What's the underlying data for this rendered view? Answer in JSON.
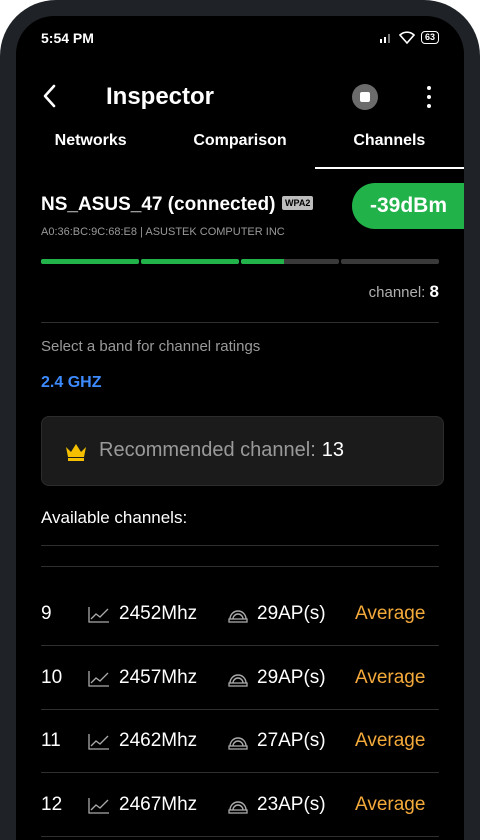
{
  "status_bar": {
    "time": "5:54 PM",
    "battery": "63"
  },
  "header": {
    "title": "Inspector"
  },
  "tabs": [
    {
      "label": "Networks"
    },
    {
      "label": "Comparison"
    },
    {
      "label": "Channels",
      "active": true
    }
  ],
  "network": {
    "name": "NS_ASUS_47 (connected)",
    "security_badge": "WPA2",
    "signal": "-39dBm",
    "mac_vendor": "A0:36:BC:9C:68:E8  | ASUSTEK COMPUTER INC",
    "signal_strength_fraction": 0.61,
    "channel_label": "channel:",
    "channel_value": "8"
  },
  "band_section": {
    "prompt": "Select a band for channel ratings",
    "selected_band": "2.4 GHZ"
  },
  "recommended": {
    "label": "Recommended channel:",
    "value": "13"
  },
  "available": {
    "heading": "Available channels:",
    "rows": [
      {
        "channel": "9",
        "frequency": "2452Mhz",
        "aps": "29AP(s)",
        "rating": "Average"
      },
      {
        "channel": "10",
        "frequency": "2457Mhz",
        "aps": "29AP(s)",
        "rating": "Average"
      },
      {
        "channel": "11",
        "frequency": "2462Mhz",
        "aps": "27AP(s)",
        "rating": "Average"
      },
      {
        "channel": "12",
        "frequency": "2467Mhz",
        "aps": "23AP(s)",
        "rating": "Average"
      }
    ]
  },
  "colors": {
    "accent_green": "#21b24a",
    "band_blue": "#3d8bff",
    "rating_orange": "#f4a93b"
  },
  "icons": [
    "back-arrow-icon",
    "record-stop-icon",
    "more-vert-icon",
    "crown-icon",
    "graph-icon",
    "access-point-icon"
  ]
}
